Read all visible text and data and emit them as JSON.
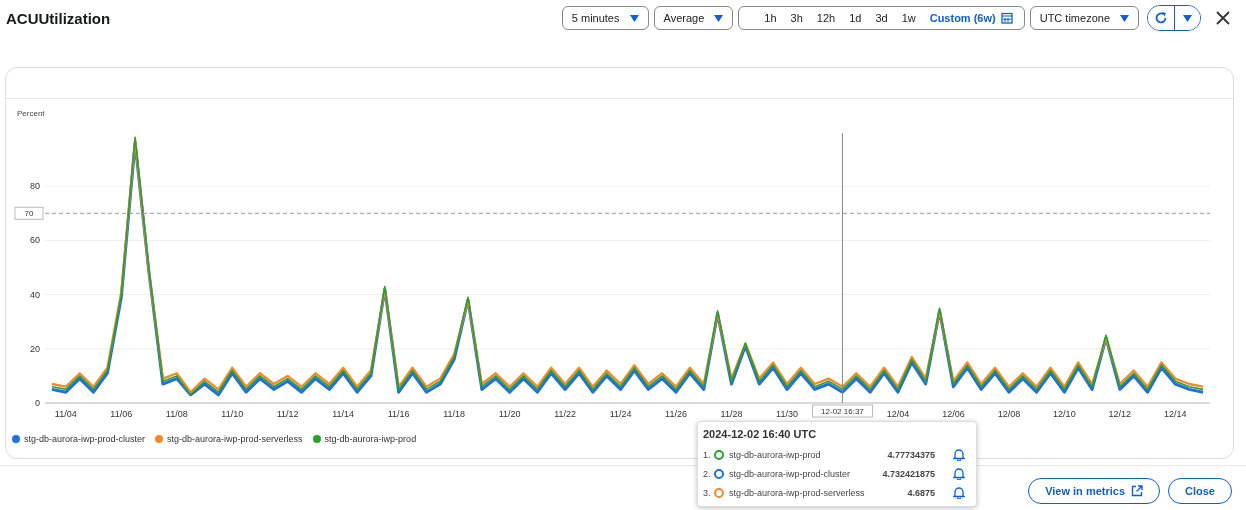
{
  "header": {
    "title": "ACUUtilization",
    "period": "5 minutes",
    "statistic": "Average",
    "ranges": [
      {
        "label": "1h",
        "selected": false
      },
      {
        "label": "3h",
        "selected": false
      },
      {
        "label": "12h",
        "selected": false
      },
      {
        "label": "1d",
        "selected": false
      },
      {
        "label": "3d",
        "selected": false
      },
      {
        "label": "1w",
        "selected": false
      },
      {
        "label": "Custom (6w)",
        "selected": true
      }
    ],
    "timezone": "UTC timezone"
  },
  "chart": {
    "chart_data": {
      "type": "line",
      "grid": true,
      "ref_lines": [
        {
          "axis": "y",
          "value": 70,
          "label": "70"
        }
      ],
      "ylabel": "Percent",
      "ylim": [
        0,
        100
      ],
      "categories": [
        null,
        "11/04",
        null,
        null,
        null,
        "11/06",
        null,
        null,
        null,
        "11/08",
        null,
        null,
        null,
        "11/10",
        null,
        null,
        null,
        "11/12",
        null,
        null,
        null,
        "11/14",
        null,
        null,
        null,
        "11/16",
        null,
        null,
        null,
        "11/18",
        null,
        null,
        null,
        "11/20",
        null,
        null,
        null,
        "11/22",
        null,
        null,
        null,
        "11/24",
        null,
        null,
        null,
        "11/26",
        null,
        null,
        null,
        "11/28",
        null,
        null,
        null,
        "11/30",
        null,
        null,
        null,
        null,
        null,
        null,
        null,
        "12/04",
        null,
        null,
        null,
        "12/06",
        null,
        null,
        null,
        "12/08",
        null,
        null,
        null,
        "12/10",
        null,
        null,
        null,
        "12/12",
        null,
        null,
        null,
        "12/14",
        null,
        null
      ],
      "yticks": [
        0,
        20,
        40,
        60,
        80
      ],
      "series": [
        {
          "name": "stg-db-aurora-iwp-prod-cluster",
          "color": "#1f6fdc",
          "values": [
            5,
            4,
            9,
            4,
            11,
            39,
            96,
            48,
            7,
            9,
            3,
            7,
            3,
            11,
            4,
            9,
            5,
            8,
            4,
            9,
            5,
            11,
            4,
            10,
            42,
            4,
            11,
            4,
            7,
            16,
            38,
            5,
            9,
            4,
            9,
            4,
            11,
            5,
            11,
            4,
            10,
            5,
            12,
            5,
            9,
            4,
            11,
            5,
            33,
            7,
            21,
            7,
            13,
            5,
            11,
            5,
            7,
            4,
            9,
            4,
            11,
            4,
            15,
            7,
            34,
            6,
            13,
            5,
            11,
            4,
            9,
            4,
            11,
            4,
            13,
            5,
            24,
            5,
            10,
            4,
            13,
            7,
            5,
            4
          ]
        },
        {
          "name": "stg-db-aurora-iwp-prod-serverless",
          "color": "#f5882a",
          "values": [
            7,
            6,
            11,
            6,
            13,
            41,
            97,
            48,
            9,
            11,
            4,
            9,
            5,
            13,
            6,
            11,
            7,
            10,
            6,
            11,
            7,
            13,
            6,
            12,
            42,
            6,
            13,
            6,
            9,
            18,
            38,
            7,
            11,
            6,
            11,
            6,
            13,
            7,
            13,
            6,
            12,
            7,
            14,
            7,
            11,
            6,
            13,
            7,
            33,
            9,
            22,
            9,
            15,
            7,
            13,
            7,
            9,
            6,
            11,
            6,
            13,
            6,
            17,
            9,
            34,
            8,
            15,
            7,
            13,
            6,
            11,
            6,
            13,
            6,
            15,
            7,
            24,
            7,
            12,
            6,
            15,
            9,
            7,
            6
          ]
        },
        {
          "name": "stg-db-aurora-iwp-prod",
          "color": "#2ca02c",
          "values": [
            6,
            5,
            10,
            5,
            12,
            40,
            98,
            49,
            8,
            10,
            3,
            8,
            4,
            12,
            5,
            10,
            6,
            9,
            5,
            10,
            6,
            12,
            5,
            11,
            43,
            5,
            12,
            5,
            8,
            17,
            39,
            6,
            10,
            5,
            10,
            5,
            12,
            6,
            12,
            5,
            11,
            6,
            13,
            6,
            10,
            5,
            12,
            6,
            34,
            8,
            22,
            8,
            14,
            6,
            12,
            6,
            8,
            5,
            10,
            5,
            12,
            5,
            16,
            8,
            35,
            7,
            14,
            6,
            12,
            5,
            10,
            5,
            12,
            5,
            14,
            6,
            25,
            6,
            11,
            5,
            14,
            8,
            6,
            5
          ]
        }
      ]
    },
    "crosshair": {
      "label": "12-02 16:37"
    }
  },
  "tooltip": {
    "title": "2024-12-02 16:40 UTC",
    "rows": [
      {
        "index": "1.",
        "name": "stg-db-aurora-iwp-prod",
        "value": "4.77734375",
        "color": "#2ca02c"
      },
      {
        "index": "2.",
        "name": "stg-db-aurora-iwp-prod-cluster",
        "value": "4.732421875",
        "color": "#1f6fdc"
      },
      {
        "index": "3.",
        "name": "stg-db-aurora-iwp-prod-serverless",
        "value": "4.6875",
        "color": "#f5882a"
      }
    ]
  },
  "footer": {
    "buttons": [
      {
        "label": "View in metrics",
        "kind": "external"
      },
      {
        "label": "Close",
        "kind": "plain"
      }
    ]
  }
}
